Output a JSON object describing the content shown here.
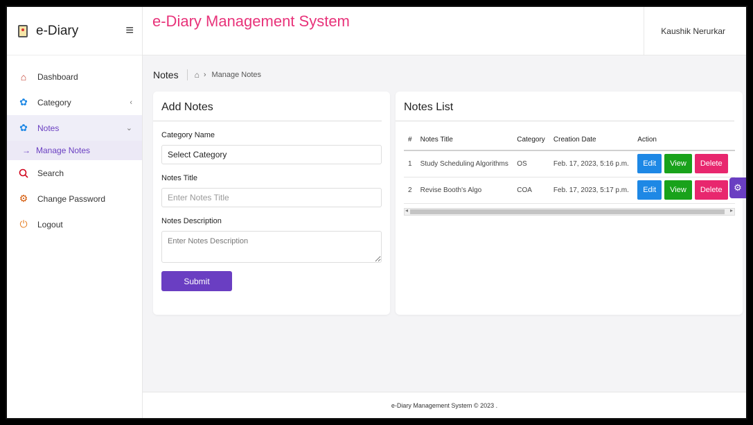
{
  "brand": {
    "name": "e-Diary"
  },
  "header": {
    "title": "e-Diary Management System",
    "user": "Kaushik Nerurkar"
  },
  "sidebar": {
    "items": [
      {
        "label": "Dashboard"
      },
      {
        "label": "Category"
      },
      {
        "label": "Notes"
      },
      {
        "label": "Manage Notes"
      },
      {
        "label": "Search"
      },
      {
        "label": "Change Password"
      },
      {
        "label": "Logout"
      }
    ]
  },
  "breadcrumb": {
    "page": "Notes",
    "current": "Manage Notes"
  },
  "add_notes": {
    "title": "Add Notes",
    "category_label": "Category Name",
    "category_value": "Select Category",
    "title_label": "Notes Title",
    "title_placeholder": "Enter Notes Title",
    "desc_label": "Notes Description",
    "desc_placeholder": "Enter Notes Description",
    "submit_label": "Submit"
  },
  "notes_list": {
    "title": "Notes List",
    "columns": [
      "#",
      "Notes Title",
      "Category",
      "Creation Date",
      "Action"
    ],
    "rows": [
      {
        "num": "1",
        "title": "Study Scheduling Algorithms",
        "category": "OS",
        "date": "Feb. 17, 2023, 5:16 p.m."
      },
      {
        "num": "2",
        "title": "Revise Booth's Algo",
        "category": "COA",
        "date": "Feb. 17, 2023, 5:17 p.m."
      }
    ],
    "actions": {
      "edit": "Edit",
      "view": "View",
      "delete": "Delete"
    }
  },
  "footer": {
    "text": "e-Diary Management System © 2023 ."
  },
  "colors": {
    "accent": "#6a3ec2",
    "title_pink": "#e8337a",
    "edit": "#1e88e5",
    "view": "#19a21b",
    "delete": "#e8276e"
  }
}
